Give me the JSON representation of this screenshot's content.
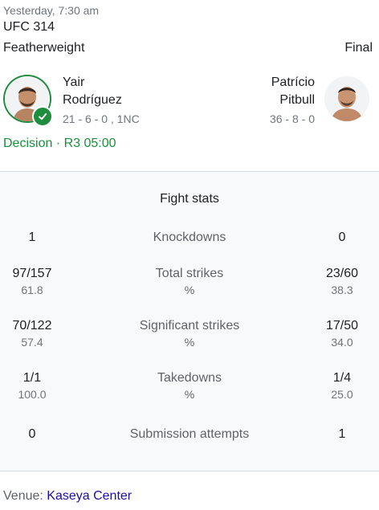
{
  "header": {
    "time": "Yesterday, 7:30 am",
    "event": "UFC 314",
    "division": "Featherweight",
    "status": "Final"
  },
  "fighters": {
    "left": {
      "first": "Yair",
      "last": "Rodríguez",
      "record": "21 - 6 - 0 , 1NC"
    },
    "right": {
      "first": "Patrício",
      "last": "Pitbull",
      "record": "36 - 8 - 0"
    }
  },
  "result": "Decision · R3 05:00",
  "stats": {
    "title": "Fight stats",
    "rows": [
      {
        "label": "Knockdowns",
        "left": "1",
        "right": "0"
      },
      {
        "label": "Total strikes",
        "unit": "%",
        "left": "97/157",
        "left_pct": "61.8",
        "right": "23/60",
        "right_pct": "38.3"
      },
      {
        "label": "Significant strikes",
        "unit": "%",
        "left": "70/122",
        "left_pct": "57.4",
        "right": "17/50",
        "right_pct": "34.0"
      },
      {
        "label": "Takedowns",
        "unit": "%",
        "left": "1/1",
        "left_pct": "100.0",
        "right": "1/4",
        "right_pct": "25.0"
      },
      {
        "label": "Submission attempts",
        "left": "0",
        "right": "1"
      }
    ]
  },
  "venue": {
    "label": "Venue:",
    "name": "Kaseya Center"
  },
  "colors": {
    "win": "#1e8e3e",
    "link": "#1a0dab",
    "muted": "#70757a"
  },
  "icons": {
    "winner_badge": "check-icon"
  }
}
